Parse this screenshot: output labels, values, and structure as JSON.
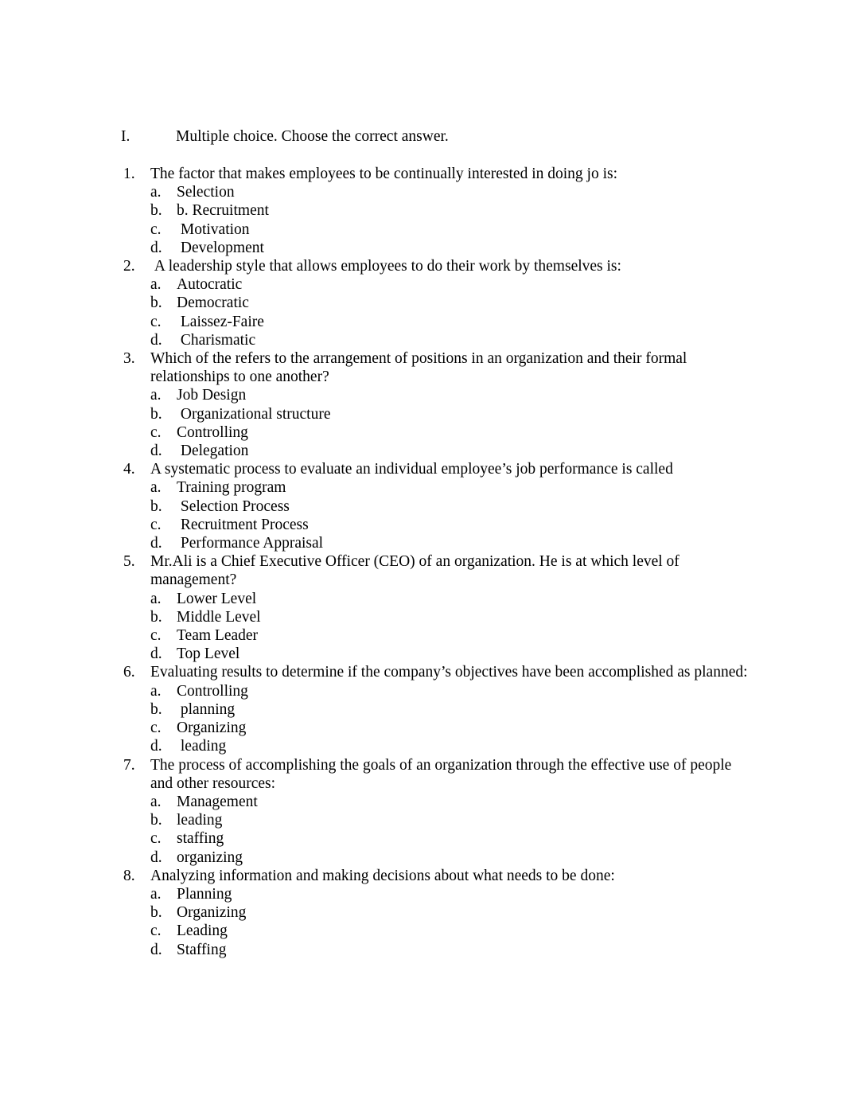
{
  "document": {
    "background_color": "#ffffff",
    "text_color": "#000000",
    "section": {
      "roman_numeral": "I.",
      "instruction": "Multiple choice. Choose the correct answer."
    },
    "questions": [
      {
        "number": "1.",
        "text": "The factor that makes employees to be continually interested in doing jo is:",
        "options": [
          {
            "letter": "a.",
            "text": "Selection"
          },
          {
            "letter": "b.",
            "text": "b. Recruitment"
          },
          {
            "letter": "c.",
            "text": " Motivation"
          },
          {
            "letter": "d.",
            "text": " Development"
          }
        ]
      },
      {
        "number": "2.",
        "text": " A leadership style that allows employees to do their work by themselves is:",
        "options": [
          {
            "letter": "a.",
            "text": "Autocratic"
          },
          {
            "letter": "b.",
            "text": "Democratic"
          },
          {
            "letter": "c.",
            "text": " Laissez-Faire"
          },
          {
            "letter": "d.",
            "text": " Charismatic"
          }
        ]
      },
      {
        "number": "3.",
        "text": "Which of the refers to the arrangement of positions in an organization and their formal relationships to one another?",
        "options": [
          {
            "letter": "a.",
            "text": "Job Design"
          },
          {
            "letter": "b.",
            "text": " Organizational structure"
          },
          {
            "letter": "c.",
            "text": "Controlling"
          },
          {
            "letter": "d.",
            "text": " Delegation"
          }
        ]
      },
      {
        "number": "4.",
        "text": "A systematic process to evaluate an individual employee’s job performance is called",
        "options": [
          {
            "letter": "a.",
            "text": "Training program"
          },
          {
            "letter": "b.",
            "text": " Selection Process"
          },
          {
            "letter": "c.",
            "text": " Recruitment Process"
          },
          {
            "letter": "d.",
            "text": " Performance Appraisal"
          }
        ]
      },
      {
        "number": "5.",
        "text": "Mr.Ali is a Chief Executive Officer (CEO) of an organization. He is at which level of management?",
        "options": [
          {
            "letter": "a.",
            "text": "Lower Level"
          },
          {
            "letter": "b.",
            "text": "Middle Level"
          },
          {
            "letter": "c.",
            "text": "Team Leader"
          },
          {
            "letter": "d.",
            "text": "Top Level"
          }
        ]
      },
      {
        "number": "6.",
        "text": "Evaluating results to determine if the company’s objectives have been accomplished as planned:",
        "options": [
          {
            "letter": "a.",
            "text": "Controlling"
          },
          {
            "letter": "b.",
            "text": " planning"
          },
          {
            "letter": "c.",
            "text": "Organizing"
          },
          {
            "letter": "d.",
            "text": " leading"
          }
        ]
      },
      {
        "number": "7.",
        "text": "The process of accomplishing the goals of an organization through the effective use of people and other resources:",
        "options": [
          {
            "letter": "a.",
            "text": "Management"
          },
          {
            "letter": "b.",
            "text": "leading"
          },
          {
            "letter": "c.",
            "text": "staffing"
          },
          {
            "letter": "d.",
            "text": "organizing"
          }
        ]
      },
      {
        "number": "8.",
        "text": "Analyzing information and making decisions about what needs to be done:",
        "options": [
          {
            "letter": "a.",
            "text": "Planning"
          },
          {
            "letter": "b.",
            "text": "Organizing"
          },
          {
            "letter": "c.",
            "text": "Leading"
          },
          {
            "letter": "d.",
            "text": "Staffing"
          }
        ]
      }
    ]
  }
}
